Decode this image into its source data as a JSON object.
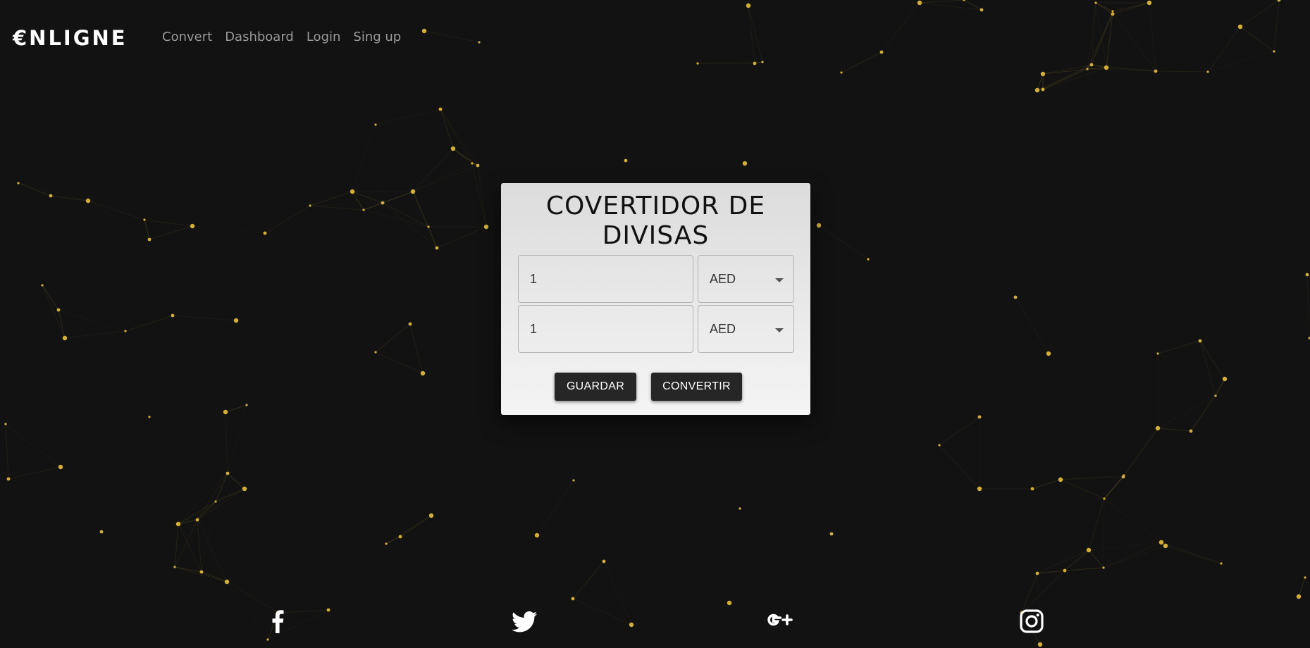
{
  "nav": {
    "logo": "€NLIGNE",
    "links": [
      "Convert",
      "Dashboard",
      "Login",
      "Sing up"
    ]
  },
  "converter": {
    "title_line1": "COVERTIDOR DE",
    "title_line2": "DIVISAS",
    "rows": [
      {
        "amount": "1",
        "currency": "AED"
      },
      {
        "amount": "1",
        "currency": "AED"
      }
    ],
    "save_label": "GUARDAR",
    "convert_label": "CONVERTIR"
  },
  "social": {
    "icons": [
      "facebook-icon",
      "twitter-icon",
      "google-plus-icon",
      "instagram-icon"
    ]
  },
  "colors": {
    "background": "#121212",
    "particle": "#d4af37",
    "nav_link": "#9a9a9a",
    "button": "#262626"
  }
}
